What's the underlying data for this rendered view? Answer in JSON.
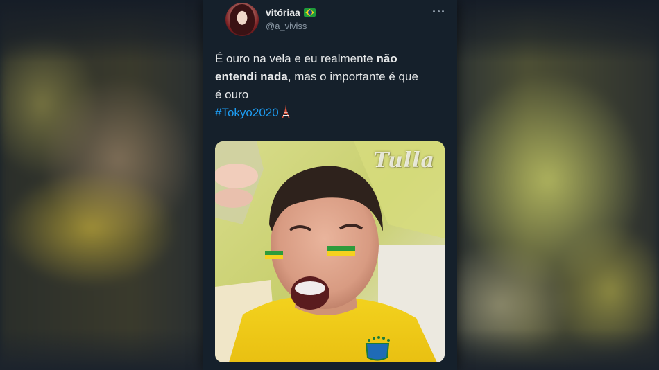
{
  "tweet": {
    "display_name": "vitóriaa",
    "handle": "@a_viviss",
    "text_plain_1": "É ouro na vela e eu realmente ",
    "text_bold_1": "não",
    "text_bold_2": "entendi nada",
    "text_plain_2": ", mas o importante é que",
    "text_plain_3": "é ouro",
    "hashtag": "#Tokyo2020",
    "icons": {
      "flag": "brazil-flag-icon",
      "more": "more-options-icon",
      "tower": "tokyo-tower-icon"
    }
  },
  "media": {
    "watermark": "Tulla"
  },
  "colors": {
    "background": "#15202b",
    "text": "#e7e9ea",
    "secondary_text": "#8b98a5",
    "link": "#1d9bf0"
  }
}
